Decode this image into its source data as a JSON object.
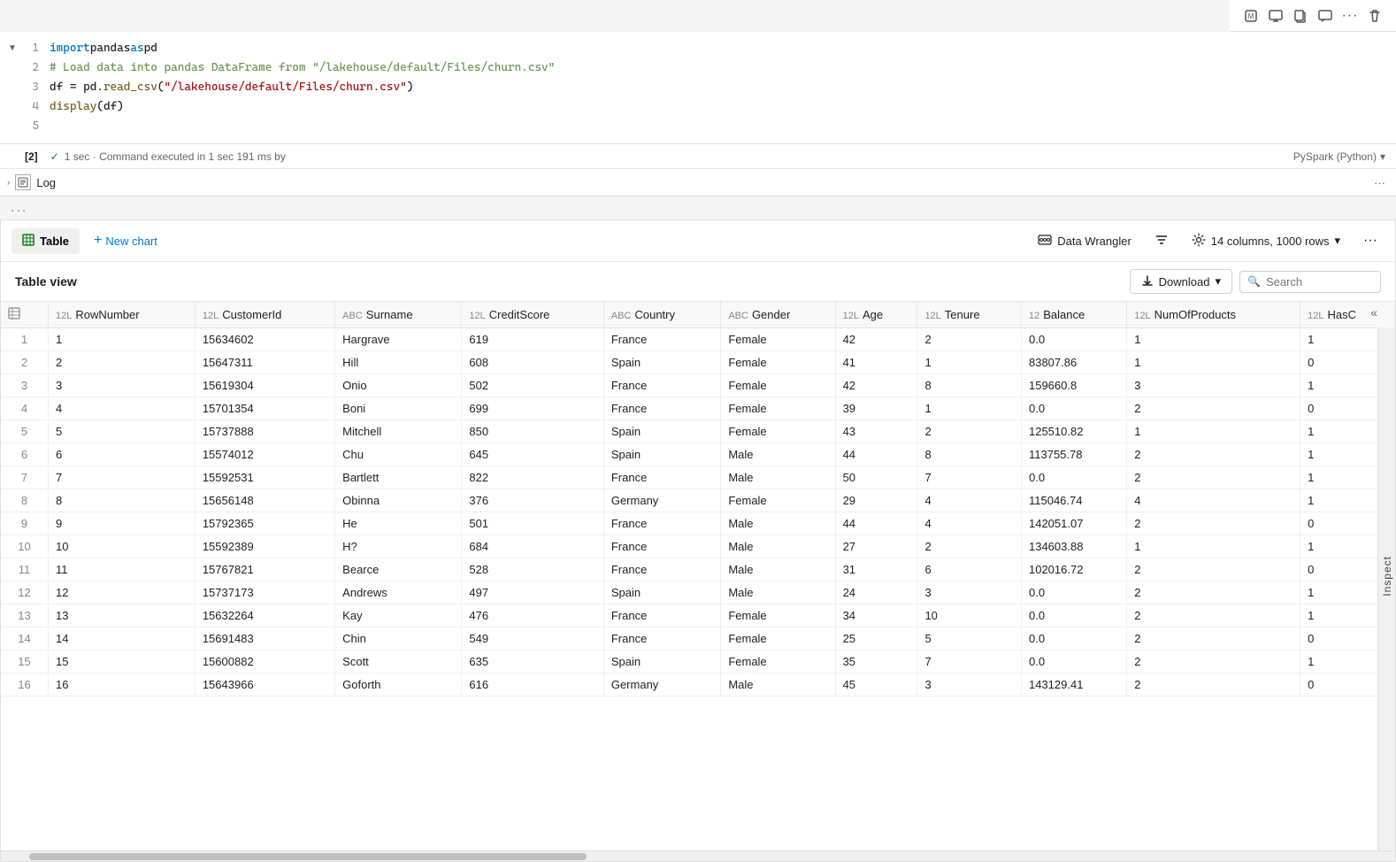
{
  "toolbar": {
    "icons": [
      "ml-icon",
      "monitor-icon",
      "copy-icon",
      "comment-icon",
      "more-icon",
      "delete-icon"
    ]
  },
  "code_cell": {
    "cell_num": "[2]",
    "exec_status": "✓",
    "exec_time": "1 sec · Command executed in 1 sec 191 ms by",
    "language": "PySpark (Python)",
    "lines": [
      {
        "num": "1",
        "content": "import pandas as pd"
      },
      {
        "num": "2",
        "content": "# Load data into pandas DataFrame from \"/lakehouse/default/Files/churn.csv\""
      },
      {
        "num": "3",
        "content": "df = pd.read_csv(\"/lakehouse/default/Files/churn.csv\")"
      },
      {
        "num": "4",
        "content": "display(df)"
      },
      {
        "num": "5",
        "content": ""
      }
    ]
  },
  "log": {
    "label": "Log",
    "more_icon": "···"
  },
  "dots_row": "...",
  "table_panel": {
    "tabs": [
      {
        "label": "Table",
        "active": true
      },
      {
        "label": "New chart",
        "active": false
      }
    ],
    "data_wrangler": "Data Wrangler",
    "col_info": "14 columns, 1000 rows",
    "table_view_title": "Table view",
    "download_label": "Download",
    "search_placeholder": "Search",
    "columns": [
      {
        "type": "12L",
        "label": "RowNumber"
      },
      {
        "type": "12L",
        "label": "CustomerId"
      },
      {
        "type": "ABC",
        "label": "Surname"
      },
      {
        "type": "12L",
        "label": "CreditScore"
      },
      {
        "type": "ABC",
        "label": "Country"
      },
      {
        "type": "ABC",
        "label": "Gender"
      },
      {
        "type": "12L",
        "label": "Age"
      },
      {
        "type": "12L",
        "label": "Tenure"
      },
      {
        "type": "12",
        "label": "Balance"
      },
      {
        "type": "12L",
        "label": "NumOfProducts"
      },
      {
        "type": "12L",
        "label": "HasC"
      }
    ],
    "rows": [
      [
        1,
        1,
        15634602,
        "Hargrave",
        619,
        "France",
        "Female",
        42,
        2,
        "0.0",
        1,
        1
      ],
      [
        2,
        2,
        15647311,
        "Hill",
        608,
        "Spain",
        "Female",
        41,
        1,
        "83807.86",
        1,
        0
      ],
      [
        3,
        3,
        15619304,
        "Onio",
        502,
        "France",
        "Female",
        42,
        8,
        "159660.8",
        3,
        1
      ],
      [
        4,
        4,
        15701354,
        "Boni",
        699,
        "France",
        "Female",
        39,
        1,
        "0.0",
        2,
        0
      ],
      [
        5,
        5,
        15737888,
        "Mitchell",
        850,
        "Spain",
        "Female",
        43,
        2,
        "125510.82",
        1,
        1
      ],
      [
        6,
        6,
        15574012,
        "Chu",
        645,
        "Spain",
        "Male",
        44,
        8,
        "113755.78",
        2,
        1
      ],
      [
        7,
        7,
        15592531,
        "Bartlett",
        822,
        "France",
        "Male",
        50,
        7,
        "0.0",
        2,
        1
      ],
      [
        8,
        8,
        15656148,
        "Obinna",
        376,
        "Germany",
        "Female",
        29,
        4,
        "115046.74",
        4,
        1
      ],
      [
        9,
        9,
        15792365,
        "He",
        501,
        "France",
        "Male",
        44,
        4,
        "142051.07",
        2,
        0
      ],
      [
        10,
        10,
        15592389,
        "H?",
        684,
        "France",
        "Male",
        27,
        2,
        "134603.88",
        1,
        1
      ],
      [
        11,
        11,
        15767821,
        "Bearce",
        528,
        "France",
        "Male",
        31,
        6,
        "102016.72",
        2,
        0
      ],
      [
        12,
        12,
        15737173,
        "Andrews",
        497,
        "Spain",
        "Male",
        24,
        3,
        "0.0",
        2,
        1
      ],
      [
        13,
        13,
        15632264,
        "Kay",
        476,
        "France",
        "Female",
        34,
        10,
        "0.0",
        2,
        1
      ],
      [
        14,
        14,
        15691483,
        "Chin",
        549,
        "France",
        "Female",
        25,
        5,
        "0.0",
        2,
        0
      ],
      [
        15,
        15,
        15600882,
        "Scott",
        635,
        "Spain",
        "Female",
        35,
        7,
        "0.0",
        2,
        1
      ],
      [
        16,
        16,
        15643966,
        "Goforth",
        616,
        "Germany",
        "Male",
        45,
        3,
        "143129.41",
        2,
        0
      ]
    ]
  }
}
